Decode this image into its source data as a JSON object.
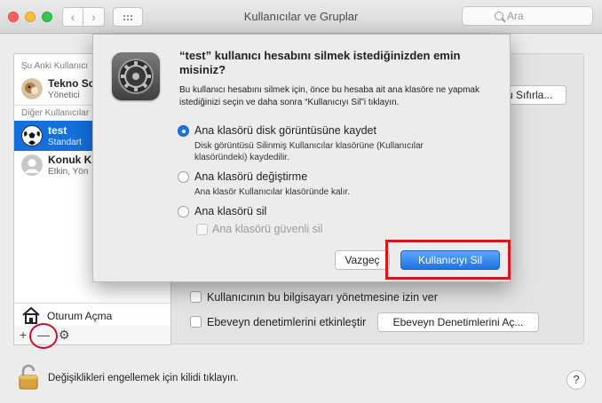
{
  "window": {
    "title": "Kullanıcılar ve Gruplar",
    "search_placeholder": "Ara",
    "nav_back": "‹",
    "nav_forward": "›"
  },
  "sidebar": {
    "current_users_header": "Şu Anki Kullanıcı",
    "other_users_header": "Diğer Kullanıcılar",
    "users": [
      {
        "name": "Tekno Sc",
        "role": "Yönetici",
        "selected": false
      },
      {
        "name": "test",
        "role": "Standart",
        "selected": true
      },
      {
        "name": "Konuk Ku",
        "role": "Etkin, Yön",
        "selected": false
      }
    ],
    "login_options_label": "Oturum Açma",
    "add_label": "+",
    "remove_label": "—",
    "gear_label": "⚙"
  },
  "main": {
    "reset_password_button": "u Sıfırla...",
    "allow_admin_label": "Kullanıcının bu bilgisayarı yönetmesine izin ver",
    "parental_controls_label": "Ebeveyn denetimlerini etkinleştir",
    "parental_controls_button": "Ebeveyn Denetimlerini Aç..."
  },
  "footer": {
    "lock_text": "Değişiklikleri engellemek için kilidi tıklayın.",
    "help_label": "?"
  },
  "dialog": {
    "title": "“test” kullanıcı hesabını silmek istediğinizden emin misiniz?",
    "info": "Bu kullanıcı hesabını silmek için, önce bu hesaba ait ana klasöre ne yapmak istediğinizi seçin ve daha sonra “Kullanıcıyı Sil”i tıklayın.",
    "options": [
      {
        "label": "Ana klasörü disk görüntüsüne kaydet",
        "description": "Disk görüntüsü Silinmiş Kullanıcılar klasörüne (Kullanıcılar klasöründeki) kaydedilir.",
        "selected": true
      },
      {
        "label": "Ana klasörü değiştirme",
        "description": "Ana klasör Kullanıcılar klasöründe kalır.",
        "selected": false
      },
      {
        "label": "Ana klasörü sil",
        "description": "",
        "selected": false
      }
    ],
    "secure_erase_label": "Ana klasörü güvenli sil",
    "cancel_button": "Vazgeç",
    "delete_button": "Kullanıcıyı Sil"
  },
  "colors": {
    "selection_blue": "#1470dd",
    "default_button_blue": "#1d72e6",
    "annotation_red": "#d0191e"
  }
}
